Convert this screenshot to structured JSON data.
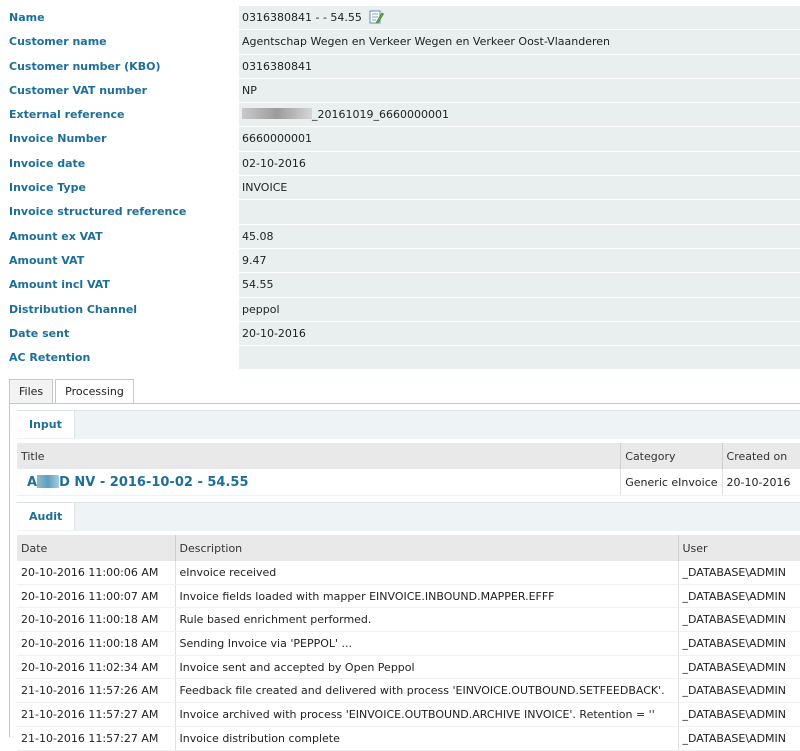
{
  "properties": [
    {
      "label": "Name",
      "value": "0316380841 - - 54.55"
    },
    {
      "label": "Customer name",
      "value": "Agentschap Wegen en Verkeer Wegen en Verkeer Oost-Vlaanderen"
    },
    {
      "label": "Customer number (KBO)",
      "value": "0316380841"
    },
    {
      "label": "Customer VAT number",
      "value": "NP"
    },
    {
      "label": "External reference",
      "value": "_20161019_6660000001"
    },
    {
      "label": "Invoice Number",
      "value": "6660000001"
    },
    {
      "label": "Invoice date",
      "value": "02-10-2016"
    },
    {
      "label": "Invoice Type",
      "value": "INVOICE"
    },
    {
      "label": "Invoice structured reference",
      "value": ""
    },
    {
      "label": "Amount ex VAT",
      "value": "45.08"
    },
    {
      "label": "Amount VAT",
      "value": "9.47"
    },
    {
      "label": "Amount incl VAT",
      "value": "54.55"
    },
    {
      "label": "Distribution Channel",
      "value": "peppol"
    },
    {
      "label": "Date sent",
      "value": "20-10-2016"
    },
    {
      "label": "AC Retention",
      "value": ""
    }
  ],
  "tabs": [
    {
      "label": "Files",
      "active": false
    },
    {
      "label": "Processing",
      "active": true
    }
  ],
  "input": {
    "section_label": "Input",
    "headers": [
      "Title",
      "Category",
      "Created on"
    ],
    "row": {
      "title_prefix": "A",
      "title_suffix": "D NV - 2016-10-02 - 54.55",
      "category": "Generic eInvoice",
      "created_on": "20-10-2016"
    }
  },
  "audit": {
    "section_label": "Audit",
    "headers": [
      "Date",
      "Description",
      "User"
    ],
    "rows": [
      {
        "date": "20-10-2016 11:00:06 AM",
        "description": "eInvoice received",
        "user": "_DATABASE\\ADMIN"
      },
      {
        "date": "20-10-2016 11:00:07 AM",
        "description": "Invoice fields loaded with mapper EINVOICE.INBOUND.MAPPER.EFFF",
        "user": "_DATABASE\\ADMIN"
      },
      {
        "date": "20-10-2016 11:00:18 AM",
        "description": "Rule based enrichment performed.",
        "user": "_DATABASE\\ADMIN"
      },
      {
        "date": "20-10-2016 11:00:18 AM",
        "description": "Sending Invoice via 'PEPPOL' ...",
        "user": "_DATABASE\\ADMIN"
      },
      {
        "date": "20-10-2016 11:02:34 AM",
        "description": "Invoice sent and accepted by Open Peppol",
        "user": "_DATABASE\\ADMIN"
      },
      {
        "date": "21-10-2016 11:57:26 AM",
        "description": "Feedback file created and delivered with process 'EINVOICE.OUTBOUND.SETFEEDBACK'.",
        "user": "_DATABASE\\ADMIN"
      },
      {
        "date": "21-10-2016 11:57:27 AM",
        "description": "Invoice archived with process 'EINVOICE.OUTBOUND.ARCHIVE INVOICE'. Retention = ''",
        "user": "_DATABASE\\ADMIN"
      },
      {
        "date": "21-10-2016 11:57:27 AM",
        "description": "Invoice distribution complete",
        "user": "_DATABASE\\ADMIN"
      }
    ]
  },
  "icons": {
    "edit": "edit-document-icon"
  },
  "colors": {
    "accent": "#1d6f9a",
    "value_bg": "#e9efef",
    "header_bg": "#e9e9e9"
  }
}
